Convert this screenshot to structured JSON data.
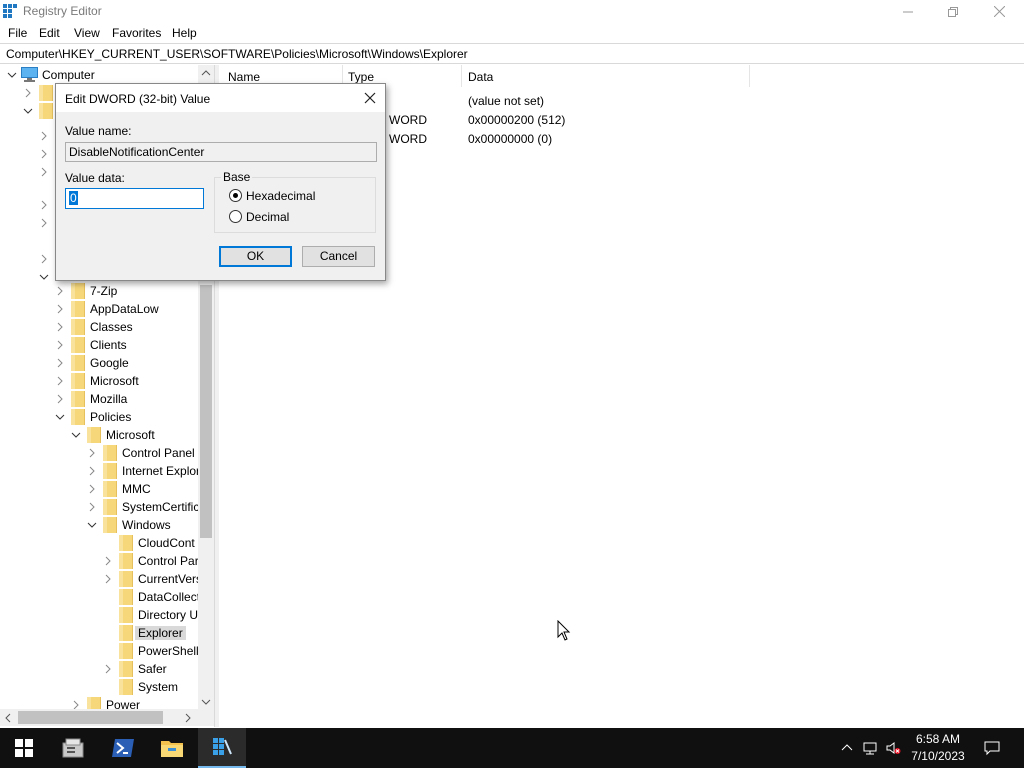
{
  "window": {
    "title": "Registry Editor"
  },
  "menu": {
    "items": [
      "File",
      "Edit",
      "View",
      "Favorites",
      "Help"
    ]
  },
  "address": {
    "path": "Computer\\HKEY_CURRENT_USER\\SOFTWARE\\Policies\\Microsoft\\Windows\\Explorer"
  },
  "tree": {
    "root": "Computer",
    "items": [
      "7-Zip",
      "AppDataLow",
      "Classes",
      "Clients",
      "Google",
      "Microsoft",
      "Mozilla",
      "Policies",
      "Microsoft",
      "Control Panel",
      "Internet Explor",
      "MMC",
      "SystemCertific",
      "Windows",
      "CloudCont",
      "Control Par",
      "CurrentVers",
      "DataCollect",
      "Directory U",
      "Explorer",
      "PowerShell",
      "Safer",
      "System",
      "Power"
    ],
    "selected": "Explorer"
  },
  "list": {
    "columns": {
      "name": "Name",
      "type": "Type",
      "data": "Data"
    },
    "rows": [
      {
        "type": "",
        "data": "(value not set)"
      },
      {
        "type": "WORD",
        "data": "0x00000200 (512)"
      },
      {
        "type": "WORD",
        "data": "0x00000000 (0)"
      }
    ]
  },
  "dialog": {
    "title": "Edit DWORD (32-bit) Value",
    "value_name_label": "Value name:",
    "value_name": "DisableNotificationCenter",
    "value_data_label": "Value data:",
    "value_data": "0",
    "base_label": "Base",
    "hex_label": "Hexadecimal",
    "dec_label": "Decimal",
    "selected_base": "Hexadecimal",
    "ok_label": "OK",
    "cancel_label": "Cancel"
  },
  "taskbar": {
    "time": "6:58 AM",
    "date": "7/10/2023"
  },
  "colors": {
    "accent": "#0078d7",
    "folder": "#f6d77a",
    "taskbar": "#101010"
  }
}
